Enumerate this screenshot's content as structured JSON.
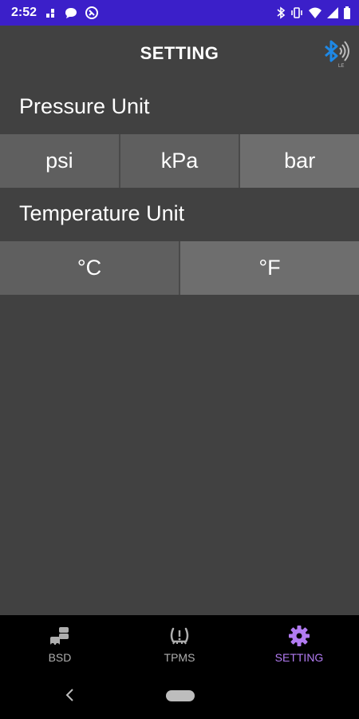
{
  "status_bar": {
    "time": "2:52",
    "left_icons": [
      "sim-icon",
      "chat-icon",
      "sync-icon"
    ],
    "right_icons": [
      "bluetooth-icon",
      "vibrate-icon",
      "wifi-icon",
      "signal-icon",
      "battery-icon"
    ]
  },
  "header": {
    "title": "SETTING",
    "bluetooth_status_icon": "bluetooth-le-icon",
    "bluetooth_badge": "LE",
    "accent_color": "#1e88e5"
  },
  "pressure": {
    "label": "Pressure Unit",
    "options": [
      "psi",
      "kPa",
      "bar"
    ],
    "selected": "bar"
  },
  "temperature": {
    "label": "Temperature Unit",
    "options": [
      "°C",
      "°F"
    ],
    "selected": "°F"
  },
  "bottom_nav": {
    "items": [
      {
        "label": "BSD",
        "icon": "car-stack-icon",
        "active": false
      },
      {
        "label": "TPMS",
        "icon": "tire-pressure-icon",
        "active": false
      },
      {
        "label": "SETTING",
        "icon": "gear-icon",
        "active": true
      }
    ],
    "active_color": "#b27bf2"
  },
  "system_nav": {
    "back_icon": "back-chevron-icon",
    "home_icon": "home-pill-icon"
  }
}
